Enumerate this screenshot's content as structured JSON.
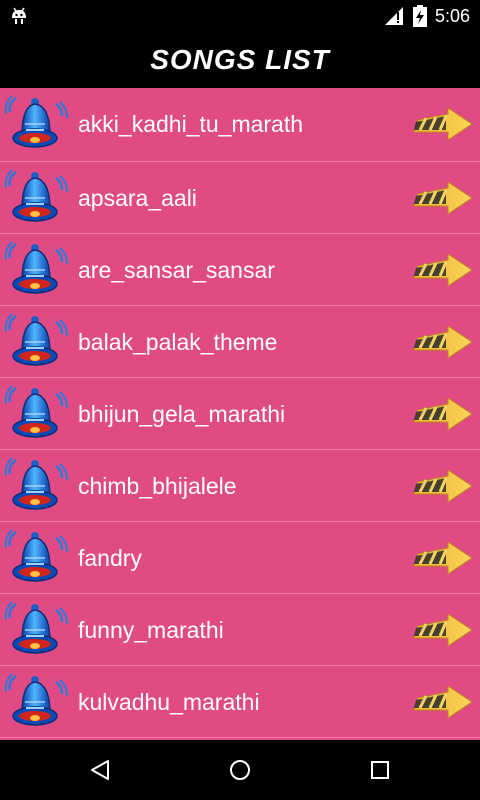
{
  "status": {
    "time": "5:06",
    "left_icon": "android-debug-icon",
    "signal_icon": "signal-icon",
    "battery_icon": "battery-charging-icon"
  },
  "header": {
    "title": "SONGS LIST"
  },
  "songs": [
    {
      "label": "akki_kadhi_tu_marath"
    },
    {
      "label": "apsara_aali"
    },
    {
      "label": "are_sansar_sansar"
    },
    {
      "label": "balak_palak_theme"
    },
    {
      "label": "bhijun_gela_marathi"
    },
    {
      "label": "chimb_bhijalele"
    },
    {
      "label": "fandry"
    },
    {
      "label": "funny_marathi"
    },
    {
      "label": "kulvadhu_marathi"
    }
  ],
  "colors": {
    "list_background": "#e04b83",
    "divider": "#f07aa6",
    "bar_background": "#000000"
  },
  "nav": {
    "back_icon": "back-icon",
    "home_icon": "home-icon",
    "recents_icon": "recents-icon"
  }
}
